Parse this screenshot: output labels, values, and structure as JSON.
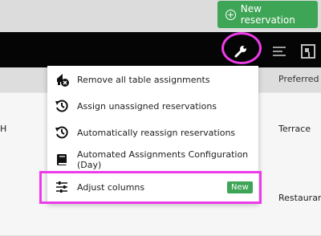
{
  "header": {
    "new_reservation_label": "New reservation"
  },
  "table": {
    "column_preferred": "Preferred",
    "rows": [
      {
        "left_cell": "H",
        "preferred": "Terrace"
      },
      {
        "left_cell": "",
        "preferred": "Restaurant"
      }
    ]
  },
  "menu": {
    "items": [
      {
        "label": "Remove all table assignments",
        "icon": "remove-assignments-icon"
      },
      {
        "label": "Assign unassigned reservations",
        "icon": "history-icon"
      },
      {
        "label": "Automatically reassign reservations",
        "icon": "history-icon"
      },
      {
        "label": "Automated Assignments Configuration (Day)",
        "icon": "book-icon"
      },
      {
        "label": "Adjust columns",
        "icon": "sliders-icon",
        "badge": "New"
      }
    ]
  },
  "colors": {
    "accent_green": "#3fa556",
    "highlight_magenta": "#ee3bea"
  }
}
